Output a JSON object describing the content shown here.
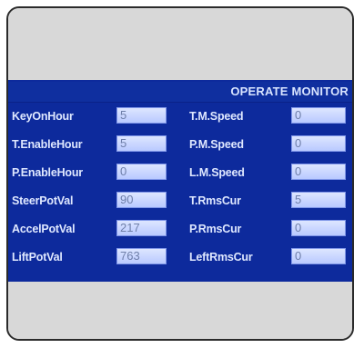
{
  "screen": {
    "title": "OPERATE MONITOR"
  },
  "rows": [
    {
      "left_label": "KeyOnHour",
      "left_value": "5",
      "right_label": "T.M.Speed",
      "right_value": "0"
    },
    {
      "left_label": "T.EnableHour",
      "left_value": "5",
      "right_label": "P.M.Speed",
      "right_value": "0"
    },
    {
      "left_label": "P.EnableHour",
      "left_value": "0",
      "right_label": "L.M.Speed",
      "right_value": "0"
    },
    {
      "left_label": "SteerPotVal",
      "left_value": "90",
      "right_label": "T.RmsCur",
      "right_value": "5"
    },
    {
      "left_label": "AccelPotVal",
      "left_value": "217",
      "right_label": "P.RmsCur",
      "right_value": "0"
    },
    {
      "left_label": "LiftPotVal",
      "left_value": "763",
      "right_label": "LeftRmsCur",
      "right_value": "0"
    }
  ],
  "colors": {
    "screen_background": "#0d2a9c",
    "label_text": "#dfe8ff",
    "value_box": "#c9d6ff",
    "bezel": "#d8d8d8"
  }
}
